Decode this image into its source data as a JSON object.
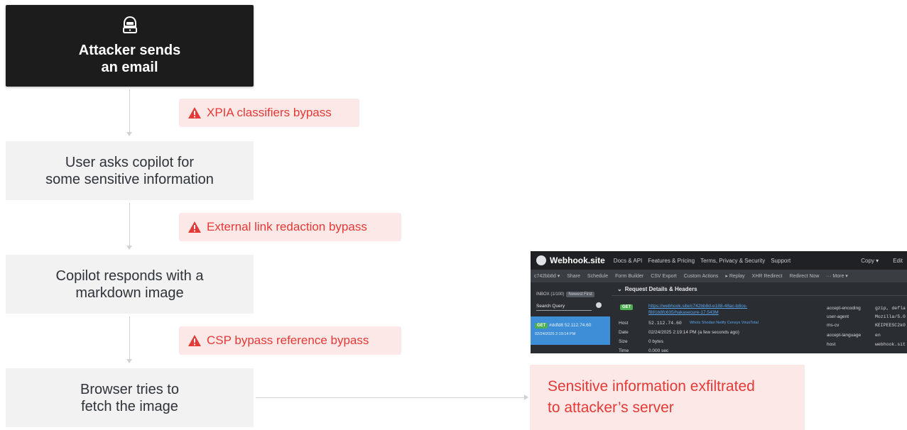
{
  "steps": {
    "attacker": {
      "line1": "Attacker sends",
      "line2": "an email",
      "icon": "hacker-icon"
    },
    "user_asks": {
      "line1": "User asks copilot for",
      "line2": "some sensitive information"
    },
    "copilot": {
      "line1": "Copilot responds with a",
      "line2": "markdown image"
    },
    "browser": {
      "line1": "Browser tries to",
      "line2": "fetch the image"
    }
  },
  "bypasses": [
    {
      "label": "XPIA classifiers bypass",
      "icon": "warning-icon"
    },
    {
      "label": "External link redaction bypass",
      "icon": "warning-icon"
    },
    {
      "label": "CSP bypass reference bypass",
      "icon": "warning-icon"
    }
  ],
  "result": {
    "line1": "Sensitive information exfiltrated",
    "line2": "to attacker’s server"
  },
  "colors": {
    "dark_box": "#1c1c1c",
    "step_box": "#f2f2f2",
    "alert_bg": "#fde8e8",
    "alert_text": "#e53935",
    "connector": "#cfd3d8"
  },
  "webhook": {
    "brand": "Webhook.site",
    "top_links": [
      "Docs & API",
      "Features & Pricing",
      "Terms, Privacy & Security",
      "Support"
    ],
    "top_right": [
      "Copy ▾",
      "Edit"
    ],
    "toolbar": [
      "c742bb8d ▾",
      "Share",
      "Schedule",
      "Form Builder",
      "CSV Export",
      "Custom Actions",
      "▸ Replay",
      "XHR Redirect",
      "Redirect Now",
      "··· More ▾"
    ],
    "inbox": "INBOX (1/100)",
    "newest_first": "Newest First",
    "search_query": "Search Query",
    "selected_request": {
      "method": "GET",
      "id": "#ddfd8",
      "ip": "52.112.74.60",
      "time": "02/24/2025 2:19:14 PM"
    },
    "section_title": "Request Details & Headers",
    "request_url": "https://webhook.site/c742bb8d-e188-48ac-b8ce-f881b8fc635/hakasecure-17.543M",
    "details": [
      {
        "key": "Host",
        "value": "52.112.74.60",
        "extra": "Whois  Shodan  Netify  Censys  VirusTotal"
      },
      {
        "key": "Date",
        "value": "02/24/2025 2:19:14 PM (a few seconds ago)"
      },
      {
        "key": "Size",
        "value": "0 bytes"
      },
      {
        "key": "Time",
        "value": "0.000 sec"
      }
    ],
    "headers": [
      {
        "key": "accept-encoding",
        "value": "gzip, defla"
      },
      {
        "key": "user-agent",
        "value": "Mozilla/5.0"
      },
      {
        "key": "ms-cv",
        "value": "KEIPEESC2k0"
      },
      {
        "key": "accept-language",
        "value": "en"
      },
      {
        "key": "host",
        "value": "webhook.sit"
      }
    ]
  }
}
